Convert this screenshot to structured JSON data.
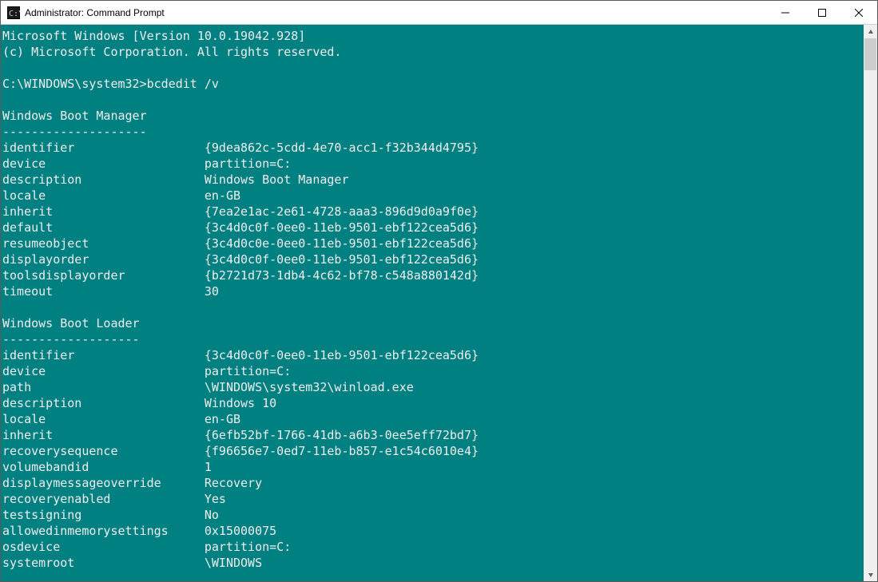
{
  "window": {
    "title": "Administrator: Command Prompt"
  },
  "header": {
    "version_line": "Microsoft Windows [Version 10.0.19042.928]",
    "copyright_line": "(c) Microsoft Corporation. All rights reserved."
  },
  "prompt": {
    "path": "C:\\WINDOWS\\system32>",
    "command": "bcdedit /v"
  },
  "sections": [
    {
      "title": "Windows Boot Manager",
      "underline": "--------------------",
      "rows": [
        {
          "key": "identifier",
          "val": "{9dea862c-5cdd-4e70-acc1-f32b344d4795}"
        },
        {
          "key": "device",
          "val": "partition=C:"
        },
        {
          "key": "description",
          "val": "Windows Boot Manager"
        },
        {
          "key": "locale",
          "val": "en-GB"
        },
        {
          "key": "inherit",
          "val": "{7ea2e1ac-2e61-4728-aaa3-896d9d0a9f0e}"
        },
        {
          "key": "default",
          "val": "{3c4d0c0f-0ee0-11eb-9501-ebf122cea5d6}"
        },
        {
          "key": "resumeobject",
          "val": "{3c4d0c0e-0ee0-11eb-9501-ebf122cea5d6}"
        },
        {
          "key": "displayorder",
          "val": "{3c4d0c0f-0ee0-11eb-9501-ebf122cea5d6}"
        },
        {
          "key": "toolsdisplayorder",
          "val": "{b2721d73-1db4-4c62-bf78-c548a880142d}"
        },
        {
          "key": "timeout",
          "val": "30"
        }
      ]
    },
    {
      "title": "Windows Boot Loader",
      "underline": "-------------------",
      "rows": [
        {
          "key": "identifier",
          "val": "{3c4d0c0f-0ee0-11eb-9501-ebf122cea5d6}"
        },
        {
          "key": "device",
          "val": "partition=C:"
        },
        {
          "key": "path",
          "val": "\\WINDOWS\\system32\\winload.exe"
        },
        {
          "key": "description",
          "val": "Windows 10"
        },
        {
          "key": "locale",
          "val": "en-GB"
        },
        {
          "key": "inherit",
          "val": "{6efb52bf-1766-41db-a6b3-0ee5eff72bd7}"
        },
        {
          "key": "recoverysequence",
          "val": "{f96656e7-0ed7-11eb-b857-e1c54c6010e4}"
        },
        {
          "key": "volumebandid",
          "val": "1"
        },
        {
          "key": "displaymessageoverride",
          "val": "Recovery"
        },
        {
          "key": "recoveryenabled",
          "val": "Yes"
        },
        {
          "key": "testsigning",
          "val": "No"
        },
        {
          "key": "allowedinmemorysettings",
          "val": "0x15000075"
        },
        {
          "key": "osdevice",
          "val": "partition=C:"
        },
        {
          "key": "systemroot",
          "val": "\\WINDOWS"
        }
      ]
    }
  ]
}
